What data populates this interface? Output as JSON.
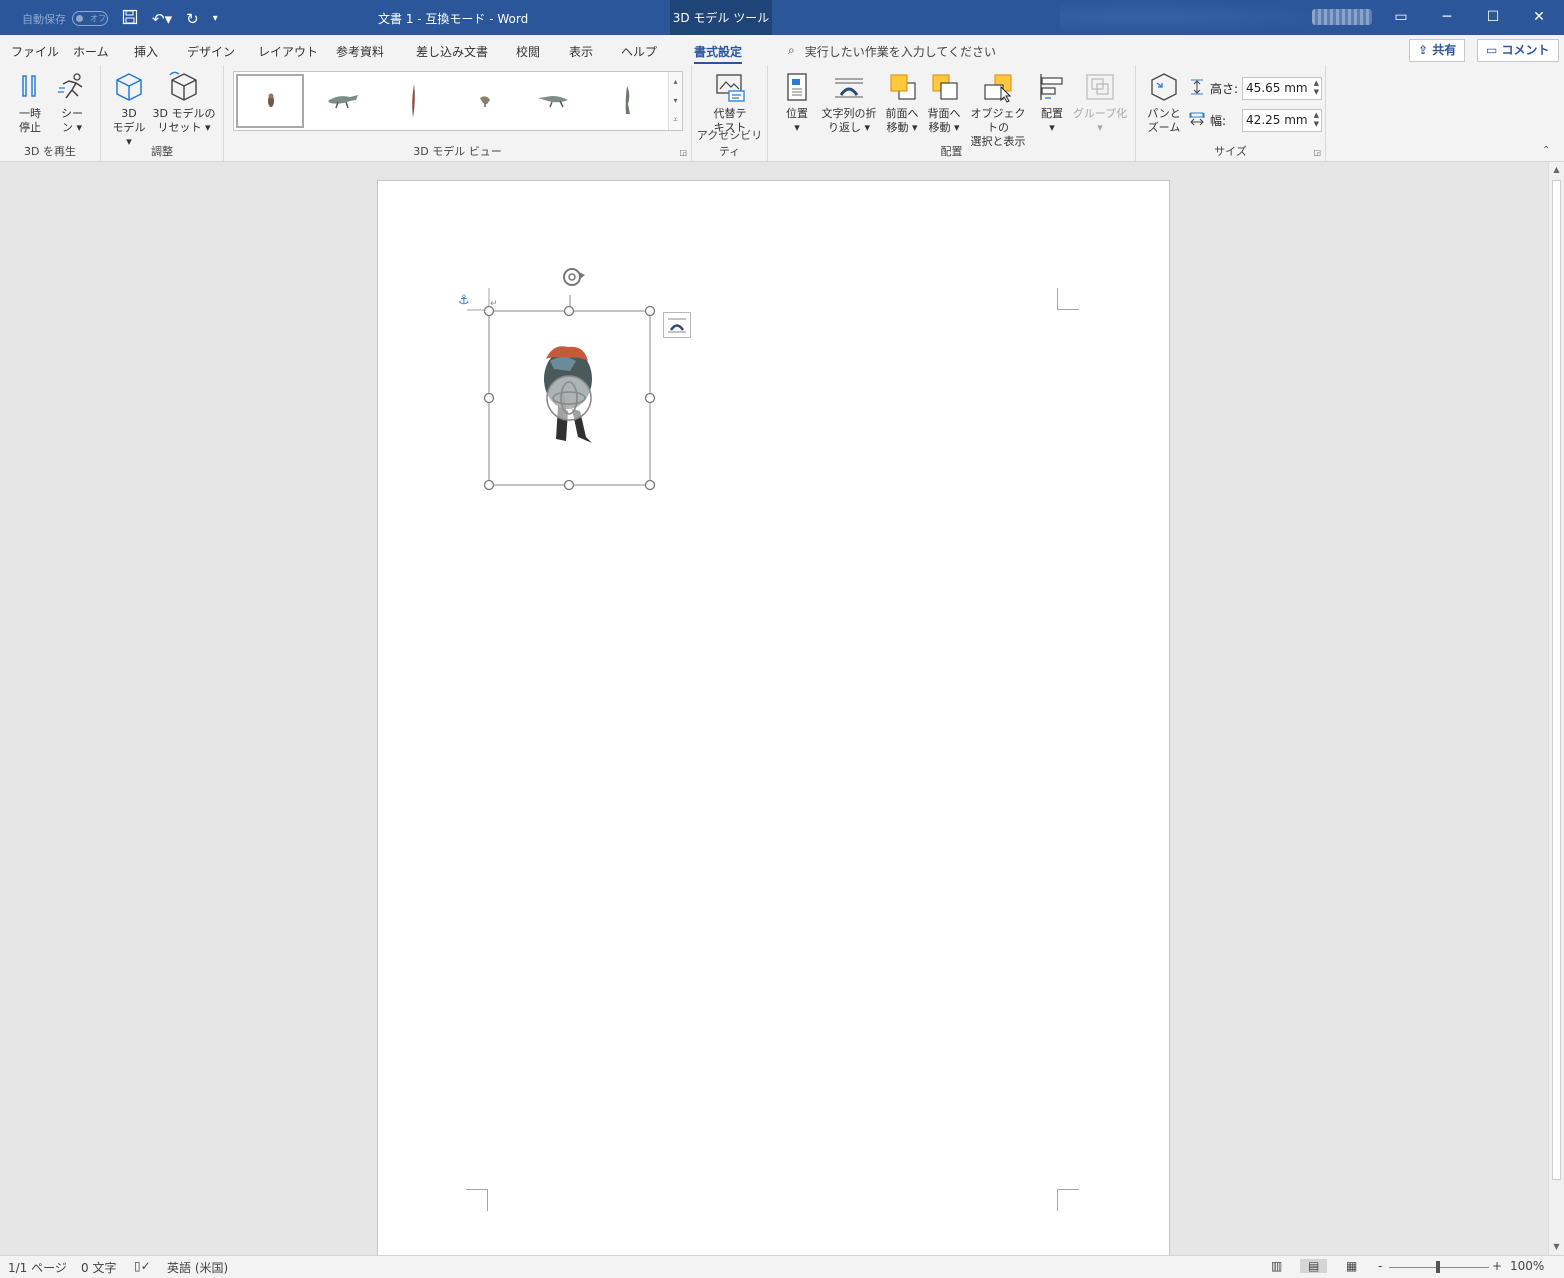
{
  "titlebar": {
    "autosave_label": "自動保存",
    "autosave_state": "オフ",
    "doc_title": "文書 1  -  互換モード  -  Word",
    "context_tab": "3D モデル ツール",
    "qat_customize": "▾"
  },
  "tabs": [
    "ファイル",
    "ホーム",
    "挿入",
    "デザイン",
    "レイアウト",
    "参考資料",
    "差し込み文書",
    "校閲",
    "表示",
    "ヘルプ",
    "書式設定"
  ],
  "active_tab": "書式設定",
  "tellme_placeholder": "実行したい作業を入力してください",
  "share_label": "共有",
  "comment_label": "コメント",
  "ribbon": {
    "play_group": {
      "label": "3D を再生",
      "pause_line1": "一時",
      "pause_line2": "停止",
      "scene_line1": "シー",
      "scene_line2": "ン ▾"
    },
    "adjust_group": {
      "label": "調整",
      "model_line1": "3D",
      "model_line2": "モデル ▾",
      "reset_line1": "3D モデルの",
      "reset_line2": "リセット ▾"
    },
    "view_group": {
      "label": "3D モデル ビュー"
    },
    "access_group": {
      "label": "アクセシビリティ",
      "alt_line1": "代替テ",
      "alt_line2": "キスト"
    },
    "arrange_group": {
      "label": "配置",
      "position_line1": "位置",
      "position_line2": "▾",
      "wrap_line1": "文字列の折",
      "wrap_line2": "り返し ▾",
      "forward_line1": "前面へ",
      "forward_line2": "移動 ▾",
      "backward_line1": "背面へ",
      "backward_line2": "移動 ▾",
      "selpane_line1": "オブジェクトの",
      "selpane_line2": "選択と表示",
      "align_line1": "配置",
      "align_line2": "▾",
      "group_line1": "グループ化",
      "group_line2": "▾"
    },
    "size_group": {
      "label": "サイズ",
      "pan_line1": "パンと",
      "pan_line2": "ズーム",
      "height_label": "高さ:",
      "height_value": "45.65 mm",
      "width_label": "幅:",
      "width_value": "42.25 mm"
    }
  },
  "statusbar": {
    "page": "1/1 ページ",
    "words": "0 文字",
    "language": "英語 (米国)",
    "zoom_minus": "-",
    "zoom_plus": "+",
    "zoom": "100%"
  },
  "colors": {
    "titlebar": "#2b579a",
    "context_tab": "#1e4478",
    "ribbon": "#f3f3f3",
    "workspace": "#e6e6e6",
    "accent_orange": "#ffc83d"
  }
}
